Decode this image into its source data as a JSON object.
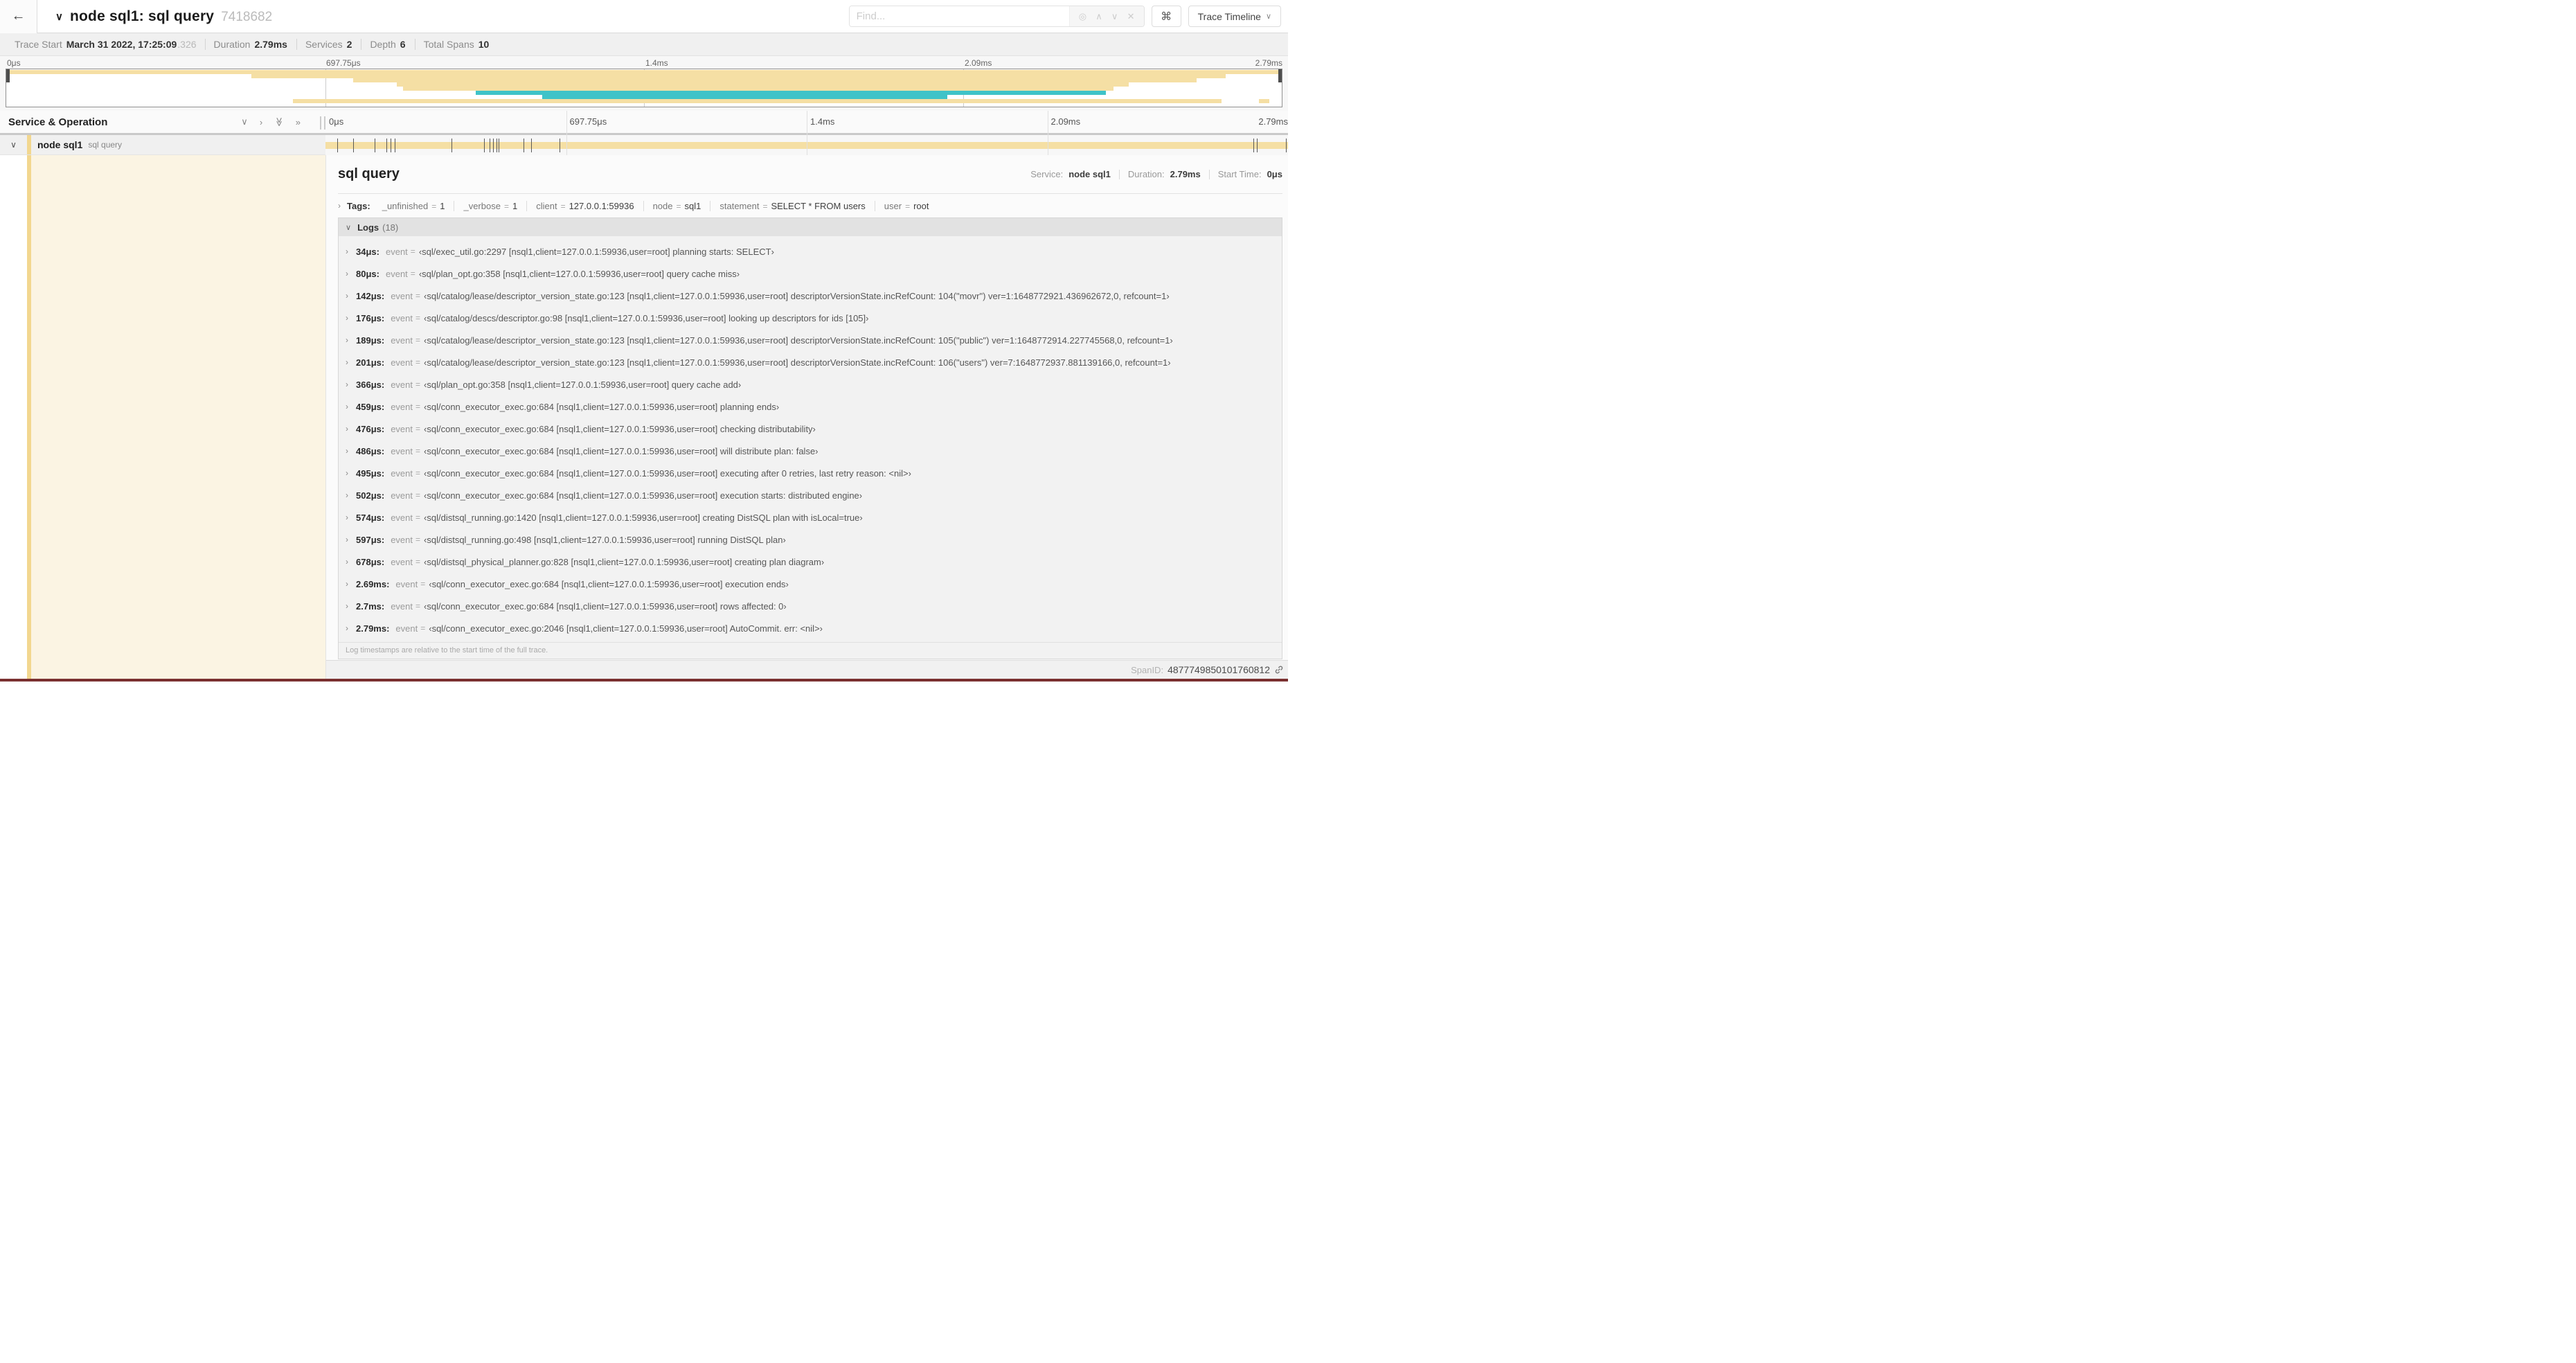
{
  "colors": {
    "tan": "#f5dfa4",
    "teal": "#3fc3c8",
    "cream": "#fbf4e3",
    "stripe": "#f2d78f"
  },
  "icons": {
    "back": "←",
    "chevron_down_bold": "∨",
    "chevron_down_small": "∨",
    "chevron_right": "›",
    "double_chevron_down": "≫",
    "double_chevron_right": "»",
    "locate": "◎",
    "up": "∧",
    "down": "∨",
    "close": "✕",
    "command": "⌘"
  },
  "topbar": {
    "title": "node sql1: sql query",
    "trace_id": "7418682",
    "find_placeholder": "Find...",
    "view_selector": "Trace Timeline"
  },
  "summary": {
    "items": [
      {
        "label": "Trace Start",
        "value": "March 31 2022, 17:25:09",
        "suffix": ".326"
      },
      {
        "label": "Duration",
        "value": "2.79ms"
      },
      {
        "label": "Services",
        "value": "2"
      },
      {
        "label": "Depth",
        "value": "6"
      },
      {
        "label": "Total Spans",
        "value": "10"
      }
    ]
  },
  "minimap": {
    "ticks": [
      {
        "label": "0μs",
        "l": 0
      },
      {
        "label": "697.75μs",
        "l": 25
      },
      {
        "label": "1.4ms",
        "l": 50
      },
      {
        "label": "2.09ms",
        "l": 75
      },
      {
        "label": "2.79ms",
        "l": 100,
        "tr": "-100%"
      }
    ],
    "bars": [
      {
        "t": 1,
        "h": 6,
        "l": 0,
        "w": 100,
        "c": "tan"
      },
      {
        "t": 7,
        "h": 6,
        "l": 19.2,
        "w": 76.4,
        "c": "tan"
      },
      {
        "t": 13,
        "h": 6,
        "l": 27.2,
        "w": 66.1,
        "c": "tan"
      },
      {
        "t": 19,
        "h": 6,
        "l": 30.6,
        "w": 57.4,
        "c": "tan"
      },
      {
        "t": 25,
        "h": 6,
        "l": 31.1,
        "w": 55.7,
        "c": "tan"
      },
      {
        "t": 31,
        "h": 6,
        "l": 36.8,
        "w": 49.4,
        "c": "teal"
      },
      {
        "t": 37,
        "h": 6,
        "l": 42.0,
        "w": 31.8,
        "c": "teal"
      },
      {
        "t": 43,
        "h": 6,
        "l": 22.5,
        "w": 72.8,
        "c": "tan"
      },
      {
        "t": 43,
        "h": 6,
        "l": 98.2,
        "w": 0.8,
        "c": "tan"
      }
    ]
  },
  "columns": {
    "left_title": "Service & Operation"
  },
  "timeline": {
    "ticks": [
      {
        "label": "0μs",
        "l": 0
      },
      {
        "label": "697.75μs",
        "l": 25
      },
      {
        "label": "1.4ms",
        "l": 50
      },
      {
        "label": "2.09ms",
        "l": 75
      },
      {
        "label": "2.79ms",
        "l": 100,
        "tr": "-100%"
      }
    ],
    "log_markers": [
      {
        "l": 1.22
      },
      {
        "l": 2.87
      },
      {
        "l": 5.09
      },
      {
        "l": 6.31
      },
      {
        "l": 6.77
      },
      {
        "l": 7.2
      },
      {
        "l": 13.12
      },
      {
        "l": 16.45
      },
      {
        "l": 17.06
      },
      {
        "l": 17.42
      },
      {
        "l": 17.74
      },
      {
        "l": 17.99
      },
      {
        "l": 20.57
      },
      {
        "l": 21.4
      },
      {
        "l": 24.3
      },
      {
        "l": 96.42
      },
      {
        "l": 96.77
      },
      {
        "l": 99.75
      }
    ]
  },
  "span_row": {
    "service": "node sql1",
    "operation": "sql query"
  },
  "detail": {
    "operation": "sql query",
    "eq": "=",
    "service_label": "Service:",
    "service": "node sql1",
    "duration_label": "Duration:",
    "duration": "2.79ms",
    "start_label": "Start Time:",
    "start": "0μs",
    "tags_label": "Tags:",
    "tags": [
      {
        "k": "_unfinished",
        "v": "1"
      },
      {
        "k": "_verbose",
        "v": "1"
      },
      {
        "k": "client",
        "v": "127.0.0.1:59936"
      },
      {
        "k": "node",
        "v": "sql1"
      },
      {
        "k": "statement",
        "v": "SELECT * FROM users"
      },
      {
        "k": "user",
        "v": "root"
      }
    ],
    "logs": {
      "label": "Logs",
      "count": "(18)",
      "note": "Log timestamps are relative to the start time of the full trace.",
      "entries": [
        {
          "t": "34μs:",
          "k": "event",
          "v": "‹sql/exec_util.go:2297 [nsql1,client=127.0.0.1:59936,user=root] planning starts: SELECT›"
        },
        {
          "t": "80μs:",
          "k": "event",
          "v": "‹sql/plan_opt.go:358 [nsql1,client=127.0.0.1:59936,user=root] query cache miss›"
        },
        {
          "t": "142μs:",
          "k": "event",
          "v": "‹sql/catalog/lease/descriptor_version_state.go:123 [nsql1,client=127.0.0.1:59936,user=root] descriptorVersionState.incRefCount: 104(\"movr\") ver=1:1648772921.436962672,0, refcount=1›"
        },
        {
          "t": "176μs:",
          "k": "event",
          "v": "‹sql/catalog/descs/descriptor.go:98 [nsql1,client=127.0.0.1:59936,user=root] looking up descriptors for ids [105]›"
        },
        {
          "t": "189μs:",
          "k": "event",
          "v": "‹sql/catalog/lease/descriptor_version_state.go:123 [nsql1,client=127.0.0.1:59936,user=root] descriptorVersionState.incRefCount: 105(\"public\") ver=1:1648772914.227745568,0, refcount=1›"
        },
        {
          "t": "201μs:",
          "k": "event",
          "v": "‹sql/catalog/lease/descriptor_version_state.go:123 [nsql1,client=127.0.0.1:59936,user=root] descriptorVersionState.incRefCount: 106(\"users\") ver=7:1648772937.881139166,0, refcount=1›"
        },
        {
          "t": "366μs:",
          "k": "event",
          "v": "‹sql/plan_opt.go:358 [nsql1,client=127.0.0.1:59936,user=root] query cache add›"
        },
        {
          "t": "459μs:",
          "k": "event",
          "v": "‹sql/conn_executor_exec.go:684 [nsql1,client=127.0.0.1:59936,user=root] planning ends›"
        },
        {
          "t": "476μs:",
          "k": "event",
          "v": "‹sql/conn_executor_exec.go:684 [nsql1,client=127.0.0.1:59936,user=root] checking distributability›"
        },
        {
          "t": "486μs:",
          "k": "event",
          "v": "‹sql/conn_executor_exec.go:684 [nsql1,client=127.0.0.1:59936,user=root] will distribute plan: false›"
        },
        {
          "t": "495μs:",
          "k": "event",
          "v": "‹sql/conn_executor_exec.go:684 [nsql1,client=127.0.0.1:59936,user=root] executing after 0 retries, last retry reason: <nil>›"
        },
        {
          "t": "502μs:",
          "k": "event",
          "v": "‹sql/conn_executor_exec.go:684 [nsql1,client=127.0.0.1:59936,user=root] execution starts: distributed engine›"
        },
        {
          "t": "574μs:",
          "k": "event",
          "v": "‹sql/distsql_running.go:1420 [nsql1,client=127.0.0.1:59936,user=root] creating DistSQL plan with isLocal=true›"
        },
        {
          "t": "597μs:",
          "k": "event",
          "v": "‹sql/distsql_running.go:498 [nsql1,client=127.0.0.1:59936,user=root] running DistSQL plan›"
        },
        {
          "t": "678μs:",
          "k": "event",
          "v": "‹sql/distsql_physical_planner.go:828 [nsql1,client=127.0.0.1:59936,user=root] creating plan diagram›"
        },
        {
          "t": "2.69ms:",
          "k": "event",
          "v": "‹sql/conn_executor_exec.go:684 [nsql1,client=127.0.0.1:59936,user=root] execution ends›"
        },
        {
          "t": "2.7ms:",
          "k": "event",
          "v": "‹sql/conn_executor_exec.go:684 [nsql1,client=127.0.0.1:59936,user=root] rows affected: 0›"
        },
        {
          "t": "2.79ms:",
          "k": "event",
          "v": "‹sql/conn_executor_exec.go:2046 [nsql1,client=127.0.0.1:59936,user=root] AutoCommit. err: <nil>›"
        }
      ]
    },
    "footer": {
      "label": "SpanID:",
      "value": "4877749850101760812"
    }
  }
}
